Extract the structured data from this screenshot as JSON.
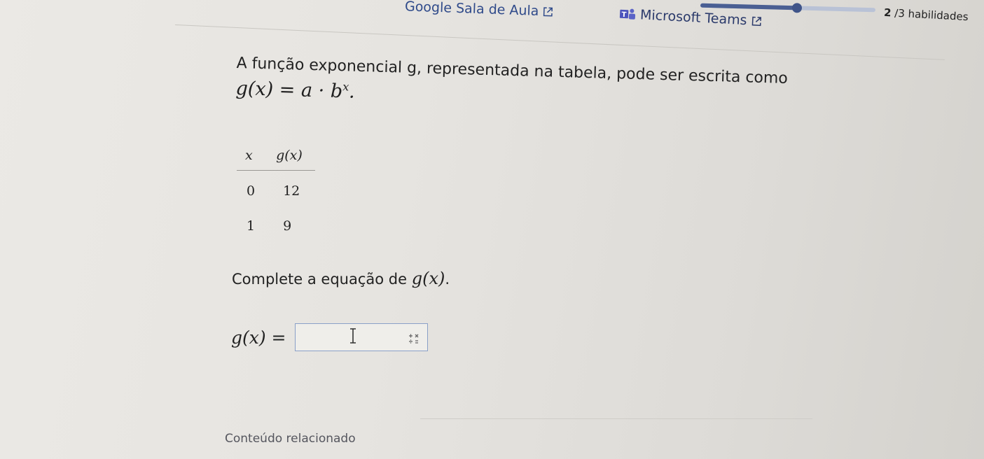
{
  "header": {
    "classroom_link": "Google Sala de Aula",
    "teams_link": "Microsoft Teams",
    "progress": {
      "fraction": 0.55
    },
    "skills": {
      "current": "2",
      "separator": "/",
      "total_label": "3 habilidades"
    }
  },
  "question": {
    "prompt": "A função exponencial g, representada na tabela, pode ser escrita como",
    "formula": {
      "lhs": "g(x) = a · b",
      "exponent": "x",
      "end": "."
    },
    "table": {
      "headers": [
        "x",
        "g(x)"
      ],
      "rows": [
        [
          "0",
          "12"
        ],
        [
          "1",
          "9"
        ]
      ]
    },
    "instruction": {
      "text": "Complete a equação de",
      "math": "g(x)",
      "end": "."
    },
    "answer": {
      "label": "g(x) =",
      "value": "",
      "placeholder": ""
    }
  },
  "footer": {
    "related": "Conteúdo relacionado"
  },
  "icons": {
    "external": "external-link-icon",
    "teams": "microsoft-teams-icon",
    "text_cursor": "text-cursor-icon",
    "keypad": "math-keypad-icon"
  },
  "colors": {
    "link": "#2f4a8a",
    "progress_fill": "#4a5f93",
    "progress_track": "#b9c2d6",
    "answer_border": "#8aa0c8"
  }
}
